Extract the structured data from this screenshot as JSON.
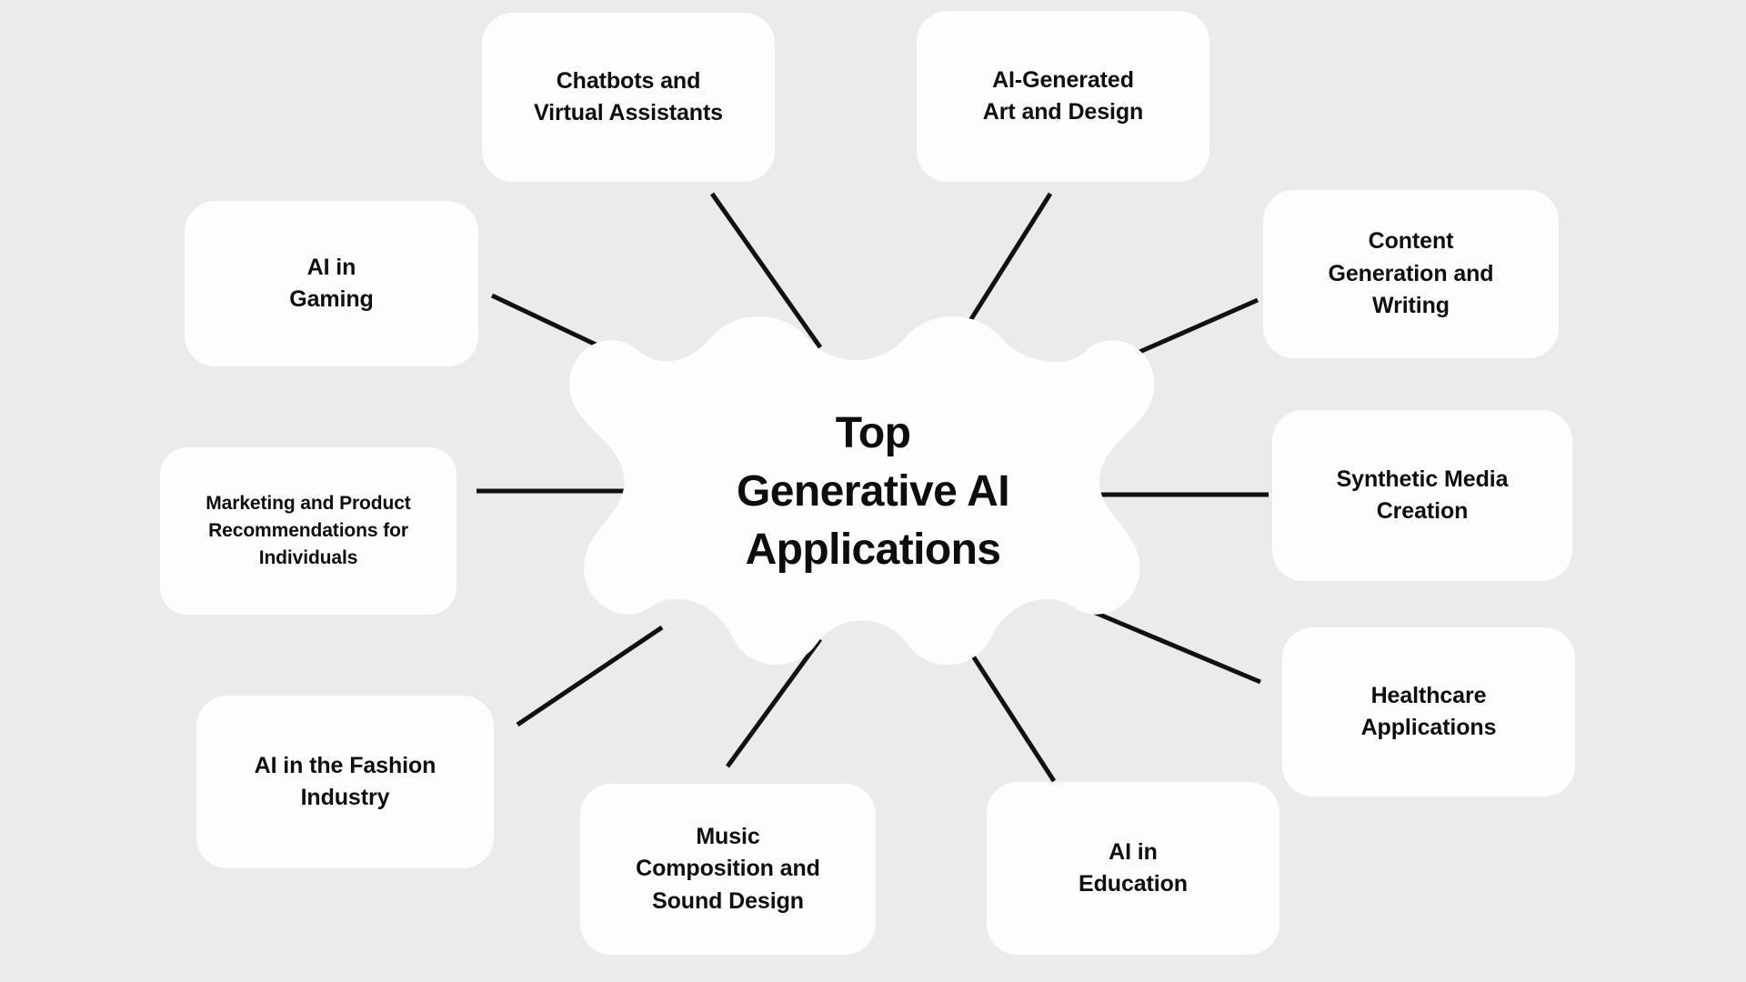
{
  "diagram": {
    "type": "mind-map",
    "background_color": "#ebebeb",
    "node_color": "#fdfdfd",
    "text_color": "#0f0f0f",
    "connector_color": "#111111",
    "center": {
      "title": "Top\nGenerative AI\nApplications",
      "shape": "scalloped-blob"
    },
    "nodes": [
      {
        "id": "chatbots",
        "label": "Chatbots and\nVirtual Assistants"
      },
      {
        "id": "artdesign",
        "label": "AI-Generated\nArt and Design"
      },
      {
        "id": "gaming",
        "label": "AI in\nGaming"
      },
      {
        "id": "content",
        "label": "Content\nGeneration and\nWriting"
      },
      {
        "id": "marketing",
        "label": "Marketing and Product\nRecommendations for\nIndividuals"
      },
      {
        "id": "synthetic",
        "label": "Synthetic Media\nCreation"
      },
      {
        "id": "fashion",
        "label": "AI in the Fashion\nIndustry"
      },
      {
        "id": "healthcare",
        "label": "Healthcare\nApplications"
      },
      {
        "id": "music",
        "label": "Music\nComposition and\nSound Design"
      },
      {
        "id": "education",
        "label": "AI in\nEducation"
      }
    ]
  }
}
